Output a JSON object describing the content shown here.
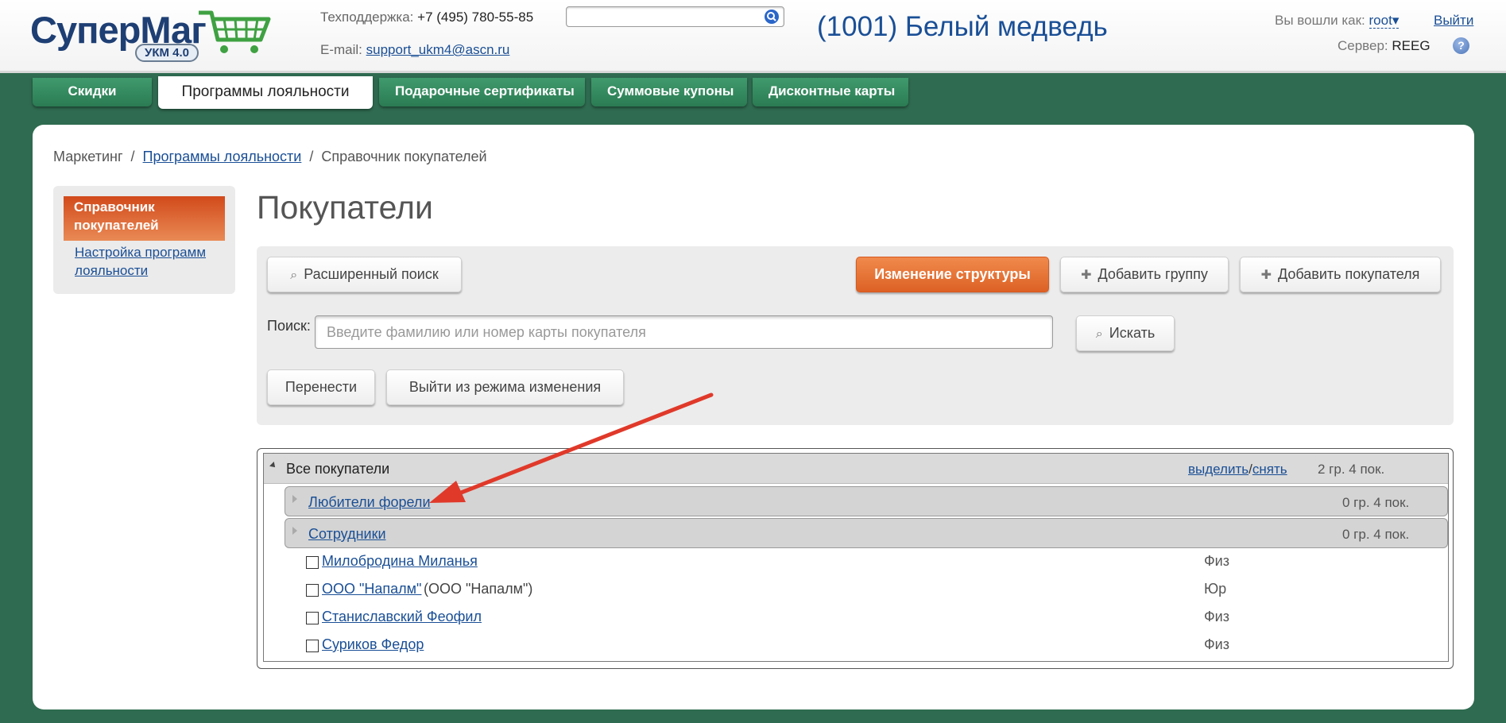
{
  "header": {
    "logo_text_a": "Супер",
    "logo_text_b": "Маг",
    "logo_badge": "УКМ 4.0",
    "support_label": "Техподдержка:",
    "support_phone": "+7 (495) 780-55-85",
    "email_label": "E-mail:",
    "email": "support_ukm4@ascn.ru",
    "search_value": "",
    "store_name": "(1001) Белый медведь",
    "login_label": "Вы вошли как:",
    "login_user": "root",
    "logout_label": "Выйти",
    "server_label": "Сервер:",
    "server_name": "REEG",
    "help_glyph": "?"
  },
  "tabs": [
    {
      "label": "Скидки",
      "active": false
    },
    {
      "label": "Программы лояльности",
      "active": true
    },
    {
      "label": "Подарочные сертификаты",
      "active": false
    },
    {
      "label": "Суммовые купоны",
      "active": false
    },
    {
      "label": "Дисконтные карты",
      "active": false
    }
  ],
  "breadcrumb": {
    "items": [
      "Маркетинг",
      "Программы лояльности",
      "Справочник покупателей"
    ],
    "separator": "/"
  },
  "sidebar": {
    "items": [
      {
        "label": "Справочник покупателей",
        "active": true
      },
      {
        "label": "Настройка программ лояльности",
        "active": false
      }
    ]
  },
  "main": {
    "title": "Покупатели",
    "buttons": {
      "advanced_search": "Расширенный поиск",
      "change_structure": "Изменение структуры",
      "add_group": "Добавить группу",
      "add_customer": "Добавить покупателя",
      "search": "Искать",
      "move": "Перенести",
      "exit_edit_mode": "Выйти из режима изменения"
    },
    "search": {
      "label": "Поиск:",
      "placeholder": "Введите фамилию или номер карты покупателя",
      "value": ""
    }
  },
  "tree": {
    "root": {
      "label": "Все покупатели",
      "select_label": "выделить",
      "select_sep": "/",
      "deselect_label": "снять",
      "count": "2 гр. 4 пок."
    },
    "groups": [
      {
        "label": "Любители форели",
        "count": "0 гр. 4 пок."
      },
      {
        "label": "Сотрудники",
        "count": "0 гр. 4 пок."
      }
    ],
    "customers": [
      {
        "name": "Милобродина Миланья",
        "extra": "",
        "type": "Физ",
        "checked": false
      },
      {
        "name": "ООО \"Напалм\"",
        "extra": "(ООО \"Напалм\")",
        "type": "Юр",
        "checked": false
      },
      {
        "name": "Станиславский Феофил",
        "extra": "",
        "type": "Физ",
        "checked": false
      },
      {
        "name": "Суриков Федор",
        "extra": "",
        "type": "Физ",
        "checked": false
      }
    ]
  },
  "colors": {
    "background": "#2f6b50",
    "tab_green": "#2f8a5e",
    "accent_orange": "#e06a2c",
    "sidebar_active": "#d24a1b",
    "link": "#1a4f96",
    "annotation_arrow": "#e0392a"
  },
  "icons": {
    "search": "magnifier-icon",
    "plus": "plus-icon",
    "help": "help-icon",
    "cart": "cart-icon"
  }
}
